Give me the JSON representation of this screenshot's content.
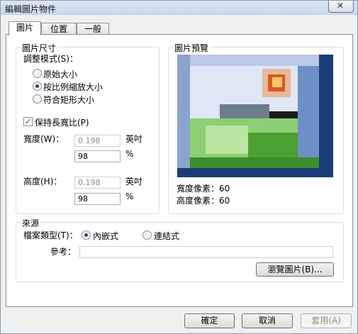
{
  "window": {
    "title": "編輯圖片物件",
    "close_label": "✕"
  },
  "tabs": [
    {
      "label": "圖片"
    },
    {
      "label": "位置"
    },
    {
      "label": "一般"
    }
  ],
  "size_group": {
    "label": "圖片尺寸",
    "adjust_mode_label": "調整模式(S)：",
    "modes": [
      "原始大小",
      "按比例縮放大小",
      "符合矩形大小"
    ],
    "selected_mode": 1,
    "keep_ratio_label": "保持長寬比(P)",
    "keep_ratio_checked": true,
    "width_label": "寬度(W)：",
    "width_value": "0.198",
    "width_unit": "英吋",
    "width_percent": "98",
    "height_label": "高度(H)：",
    "height_value": "0.198",
    "height_unit": "英吋",
    "height_percent": "98",
    "percent_sign": "%"
  },
  "preview_group": {
    "label": "圖片預覽",
    "width_pixels": "寬度像素：60",
    "height_pixels": "高度像素：60"
  },
  "source_group": {
    "label": "來源",
    "file_type_label": "檔案類型(T)：",
    "embedded_label": "內嵌式",
    "linked_label": "連結式",
    "selected": "embedded",
    "reference_label": "參考：",
    "reference_value": "",
    "browse_label": "瀏覽圖片(B)..."
  },
  "buttons": {
    "ok": "確定",
    "cancel": "取消",
    "apply": "套用(A)"
  }
}
